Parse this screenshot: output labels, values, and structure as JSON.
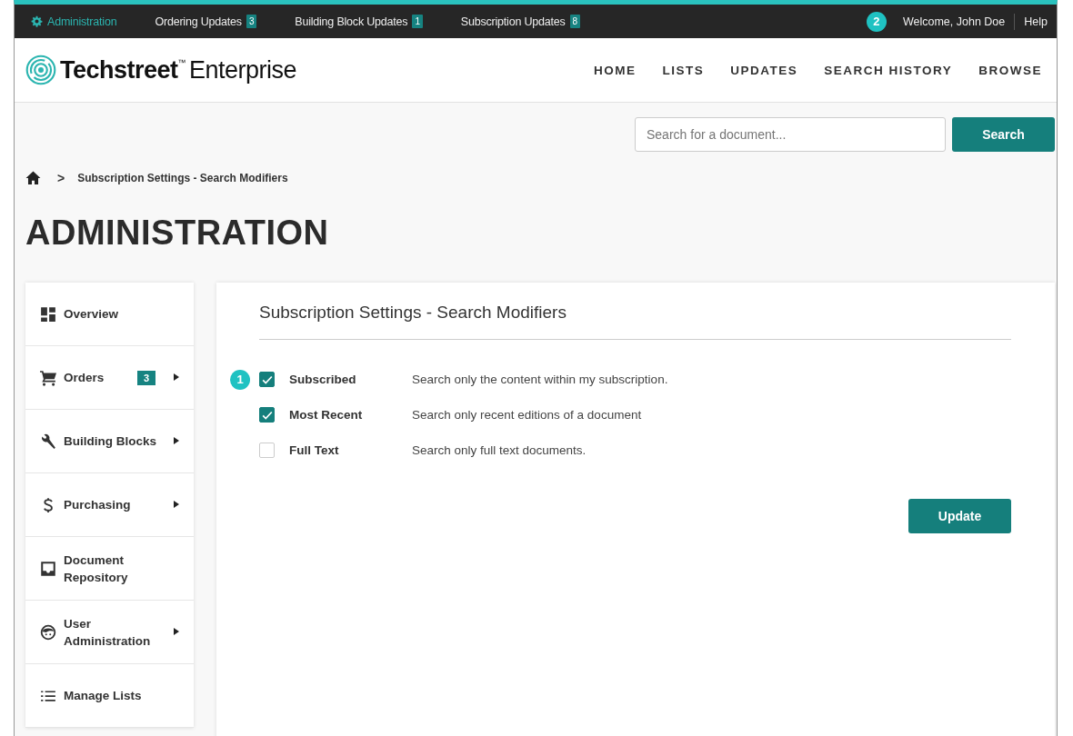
{
  "top_bar": {
    "items": [
      {
        "label": "Administration",
        "selected": true
      },
      {
        "label": "Ordering Updates",
        "selected": false,
        "badge": "3"
      },
      {
        "label": "Building Block Updates",
        "selected": false,
        "badge": "1"
      },
      {
        "label": "Subscription Updates",
        "selected": false,
        "badge": "8"
      }
    ],
    "callout": "2",
    "welcome": "Welcome, John Doe",
    "help": "Help"
  },
  "header": {
    "logo_brand": "Techstreet",
    "logo_tm": "™",
    "logo_product": "Enterprise",
    "nav": [
      "HOME",
      "LISTS",
      "UPDATES",
      "SEARCH HISTORY",
      "BROWSE"
    ]
  },
  "search": {
    "placeholder": "Search for a document...",
    "button": "Search"
  },
  "breadcrumb": {
    "current": "Subscription Settings - Search Modifiers",
    "separator": ">"
  },
  "page_title": "ADMINISTRATION",
  "sidebar": {
    "items": [
      {
        "label": "Overview",
        "submenu": false
      },
      {
        "label": "Orders",
        "badge": "3",
        "submenu": true
      },
      {
        "label": "Building Blocks",
        "submenu": true
      },
      {
        "label": "Purchasing",
        "submenu": true
      },
      {
        "label": "Document Repository",
        "submenu": false
      },
      {
        "label": "User Administration",
        "submenu": true
      },
      {
        "label": "Manage Lists",
        "submenu": false
      }
    ]
  },
  "panel": {
    "title": "Subscription Settings - Search Modifiers",
    "callout": "1",
    "options": [
      {
        "label": "Subscribed",
        "description": "Search only the content within my subscription.",
        "checked": true
      },
      {
        "label": "Most Recent",
        "description": "Search only recent editions of a document",
        "checked": true
      },
      {
        "label": "Full Text",
        "description": "Search only full text documents.",
        "checked": false
      }
    ],
    "button": "Update"
  }
}
